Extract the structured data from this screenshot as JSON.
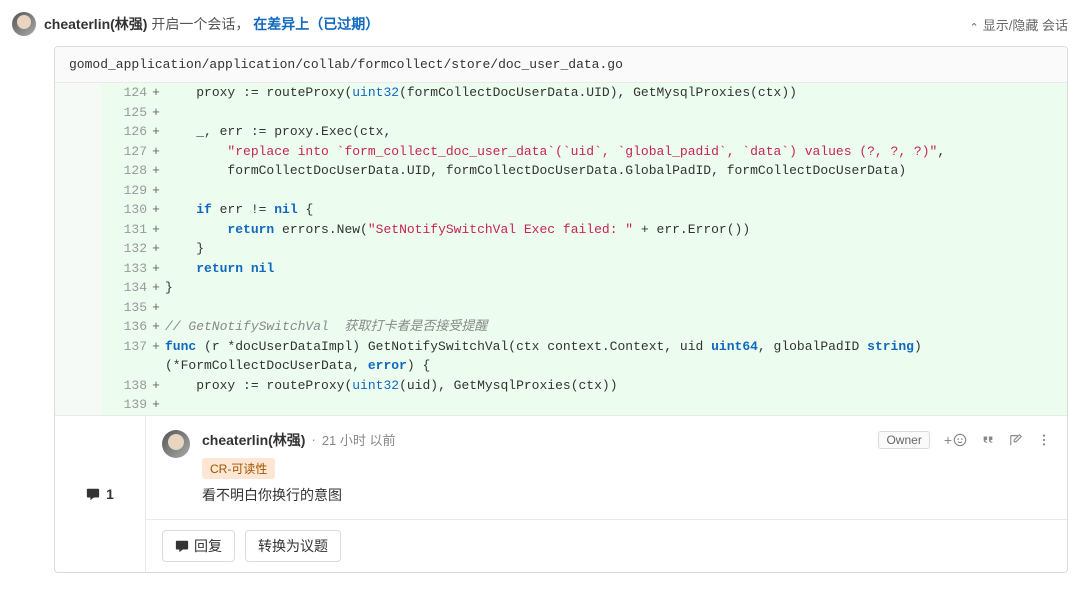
{
  "header": {
    "author": "cheaterlin(林强)",
    "action_text": " 开启一个会话，",
    "diff_link_text": "在差异上（已过期）",
    "toggle_text": "显示/隐藏 会话"
  },
  "file": {
    "path": "gomod_application/application/collab/formcollect/store/doc_user_data.go"
  },
  "code_lines": [
    {
      "ln": 124,
      "sign": "+",
      "html": "    proxy := routeProxy(<span class='tok-builtin'>uint32</span>(formCollectDocUserData.UID), GetMysqlProxies(ctx))"
    },
    {
      "ln": 125,
      "sign": "+",
      "html": ""
    },
    {
      "ln": 126,
      "sign": "+",
      "html": "    _, err := proxy.Exec(ctx,"
    },
    {
      "ln": 127,
      "sign": "+",
      "html": "        <span class='tok-str'>\"replace into `form_collect_doc_user_data`(`uid`, `global_padid`, `data`) values (?, ?, ?)\"</span>,"
    },
    {
      "ln": 128,
      "sign": "+",
      "html": "        formCollectDocUserData.UID, formCollectDocUserData.GlobalPadID, formCollectDocUserData)"
    },
    {
      "ln": 129,
      "sign": "+",
      "html": ""
    },
    {
      "ln": 130,
      "sign": "+",
      "html": "    <span class='tok-kw'>if</span> err != <span class='tok-kw'>nil</span> {"
    },
    {
      "ln": 131,
      "sign": "+",
      "html": "        <span class='tok-kw'>return</span> errors.New(<span class='tok-str'>\"SetNotifySwitchVal Exec failed: \"</span> + err.Error())"
    },
    {
      "ln": 132,
      "sign": "+",
      "html": "    }"
    },
    {
      "ln": 133,
      "sign": "+",
      "html": "    <span class='tok-kw'>return</span> <span class='tok-kw'>nil</span>"
    },
    {
      "ln": 134,
      "sign": "+",
      "html": "}"
    },
    {
      "ln": 135,
      "sign": "+",
      "html": ""
    },
    {
      "ln": 136,
      "sign": "+",
      "html": "<span class='tok-cmt'>// GetNotifySwitchVal  获取打卡者是否接受提醒</span>"
    },
    {
      "ln": 137,
      "sign": "+",
      "html": "<span class='tok-kw'>func</span> (r *docUserDataImpl) GetNotifySwitchVal(ctx context.Context, uid <span class='tok-type'>uint64</span>, globalPadID <span class='tok-type'>string</span>) (*FormCollectDocUserData, <span class='tok-type'>error</span>) {"
    },
    {
      "ln": 138,
      "sign": "+",
      "html": "    proxy := routeProxy(<span class='tok-builtin'>uint32</span>(uid), GetMysqlProxies(ctx))"
    },
    {
      "ln": 139,
      "sign": "+",
      "html": ""
    }
  ],
  "comment": {
    "count": "1",
    "author": "cheaterlin(林强)",
    "separator": "·",
    "time": "21 小时 以前",
    "owner_badge": "Owner",
    "tag": "CR-可读性",
    "body": "看不明白你换行的意图"
  },
  "reply_bar": {
    "reply_label": "回复",
    "convert_label": "转换为议题"
  }
}
